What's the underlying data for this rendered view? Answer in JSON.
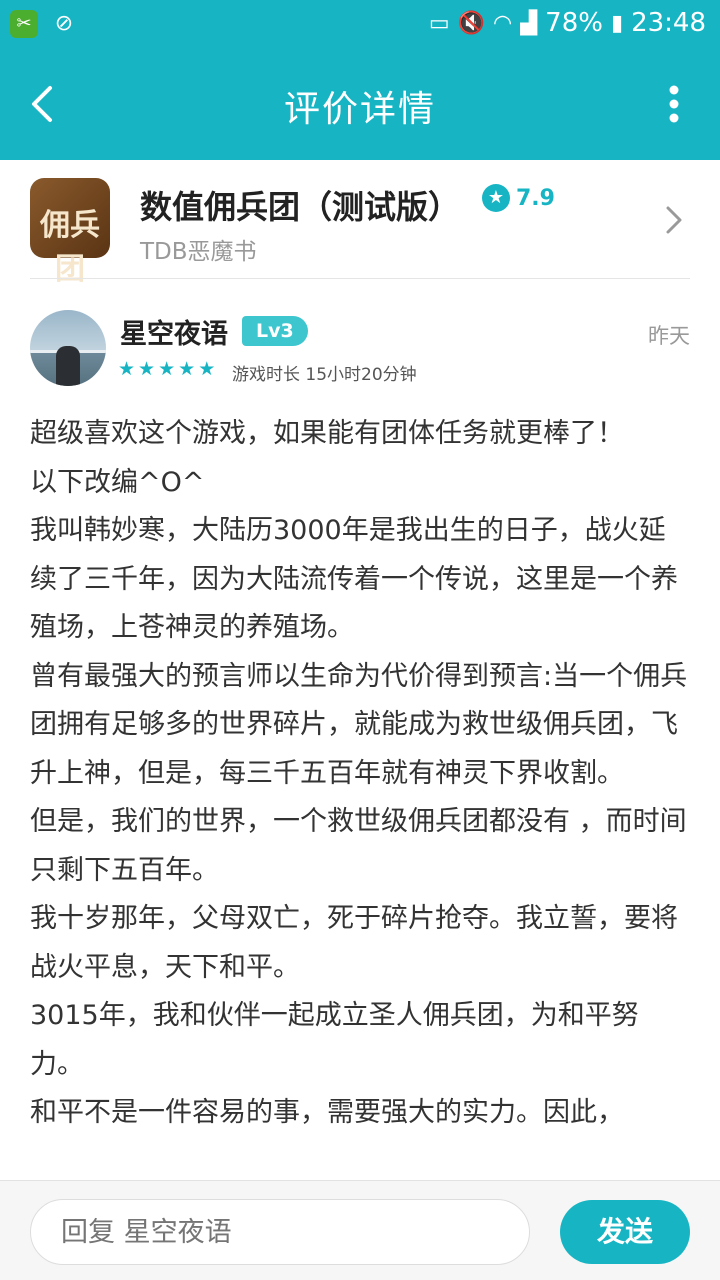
{
  "status_bar": {
    "battery": "78%",
    "time": "23:48"
  },
  "header": {
    "title": "评价详情"
  },
  "app": {
    "logo_text": "佣兵团",
    "name": "数值佣兵团（测试版）",
    "rating": "7.9",
    "developer": "TDB恶魔书"
  },
  "review": {
    "username": "星空夜语",
    "level": "Lv3",
    "time": "昨天",
    "stars": 5,
    "playtime": "游戏时长 15小时20分钟",
    "paragraphs": [
      "超级喜欢这个游戏，如果能有团体任务就更棒了！",
      "以下改编^O^",
      "我叫韩妙寒，大陆历3000年是我出生的日子，战火延续了三千年，因为大陆流传着一个传说，这里是一个养殖场，上苍神灵的养殖场。",
      "曾有最强大的预言师以生命为代价得到预言:当一个佣兵团拥有足够多的世界碎片，就能成为救世级佣兵团，飞升上神，但是，每三千五百年就有神灵下界收割。",
      "但是，我们的世界，一个救世级佣兵团都没有 ，而时间只剩下五百年。",
      "我十岁那年，父母双亡，死于碎片抢夺。我立誓，要将战火平息，天下和平。",
      "3015年，我和伙伴一起成立圣人佣兵团，为和平努力。",
      "和平不是一件容易的事，需要强大的实力。因此，"
    ]
  },
  "reply": {
    "placeholder": "回复 星空夜语",
    "send_label": "发送"
  }
}
